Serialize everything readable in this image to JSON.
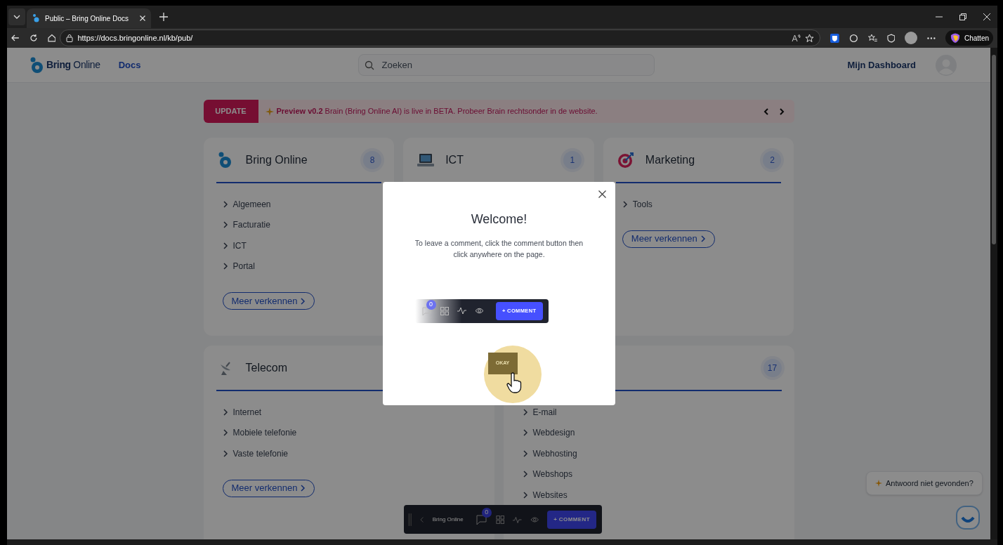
{
  "browser": {
    "tab_title": "Public – Bring Online Docs",
    "url": "https://docs.bringonline.nl/kb/pub/",
    "chat_button": "Chatten"
  },
  "header": {
    "logo_bold": "Bring",
    "logo_light": "Online",
    "nav": "Docs",
    "search": {
      "placeholder": "Zoeken"
    },
    "dashboard": "Mijn Dashboard"
  },
  "banner": {
    "label": "UPDATE",
    "text": "**Preview v0.2** Brain (Bring Online AI) is live in BETA. Probeer Brain rechtsonder in de website."
  },
  "categories": [
    {
      "title": "Bring Online",
      "count": "8",
      "items": [
        "Algemeen",
        "Facturatie",
        "ICT",
        "Portal"
      ],
      "more": "Meer verkennen"
    },
    {
      "title": "ICT",
      "count": "1"
    },
    {
      "title": "Marketing",
      "count": "2",
      "items": [
        "Tools"
      ],
      "more": "Meer verkennen"
    },
    {
      "title": "Telecom",
      "items": [
        "Internet",
        "Mobiele telefonie",
        "Vaste telefonie"
      ],
      "more": "Meer verkennen"
    },
    {
      "count": "17",
      "items": [
        "E-mail",
        "Webdesign",
        "Webhosting",
        "Webshops",
        "Websites"
      ]
    }
  ],
  "modal": {
    "title": "Welcome!",
    "text": "To leave a comment, click the comment button then click anywhere on the page.",
    "demo_badge": "0",
    "demo_button": "+ COMMENT",
    "okay": "OKAY"
  },
  "toolbar": {
    "brand": "Bring Online",
    "badge": "0",
    "comment": "+ COMMENT"
  },
  "chat": {
    "prompt": "Antwoord niet gevonden?"
  }
}
